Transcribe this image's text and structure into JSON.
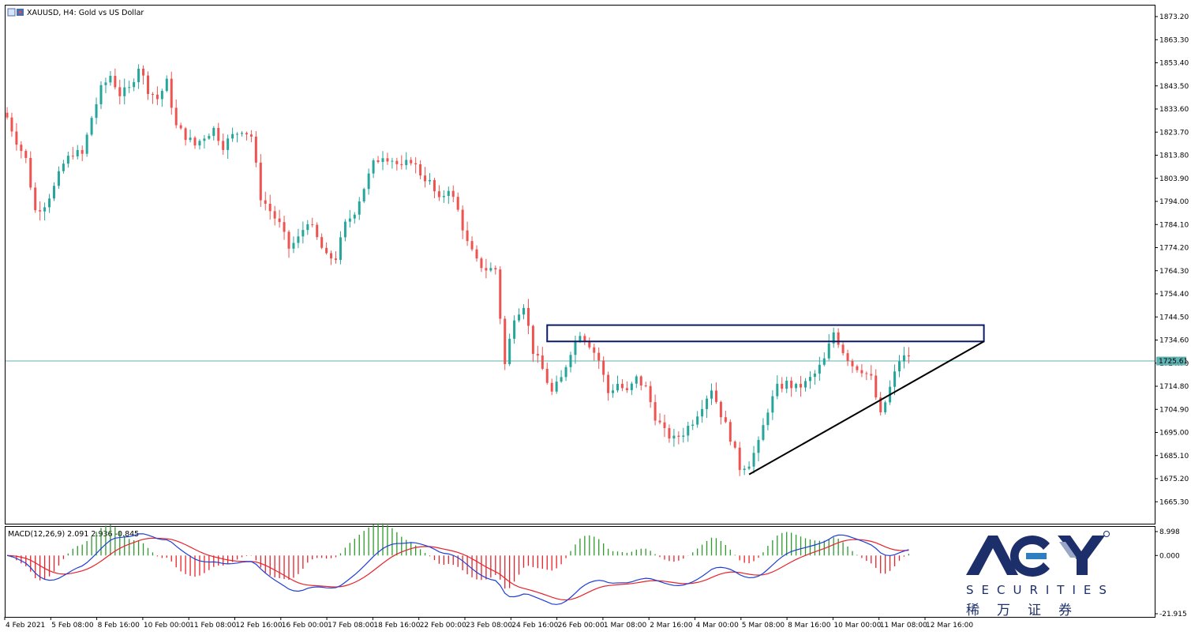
{
  "window": {
    "title": "XAUUSD, H4:  Gold vs US Dollar",
    "current_price_label": "1725.61"
  },
  "colors": {
    "bull": "#26a69a",
    "bear": "#ef5350",
    "macd_line": "#1e3fd6",
    "signal_line": "#e8222a",
    "hist_pos": "#2e9a2e",
    "hist_neg": "#e8222a",
    "price_line": "#5fb3b3",
    "box": "#0a1a66",
    "trendline": "#000000",
    "brand": "#1d2f6b"
  },
  "chart_data": [
    {
      "type": "candlestick",
      "title": "XAUUSD, H4:  Gold vs US Dollar",
      "price_axis": {
        "ticks": [
          "1873.20",
          "1863.30",
          "1853.40",
          "1843.50",
          "1833.60",
          "1823.70",
          "1813.80",
          "1803.90",
          "1794.00",
          "1784.10",
          "1774.20",
          "1764.30",
          "1754.40",
          "1744.50",
          "1734.60",
          "1724.70",
          "1714.80",
          "1704.90",
          "1695.00",
          "1685.10",
          "1675.20",
          "1665.30"
        ]
      },
      "time_axis": {
        "labels": [
          "4 Feb 2021",
          "5 Feb 08:00",
          "8 Feb 16:00",
          "10 Feb 00:00",
          "11 Feb 08:00",
          "12 Feb 16:00",
          "16 Feb 00:00",
          "17 Feb 08:00",
          "18 Feb 16:00",
          "22 Feb 00:00",
          "23 Feb 08:00",
          "24 Feb 16:00",
          "26 Feb 00:00",
          "1 Mar 08:00",
          "2 Mar 16:00",
          "4 Mar 00:00",
          "5 Mar 08:00",
          "8 Mar 16:00",
          "10 Mar 00:00",
          "11 Mar 08:00",
          "12 Mar 16:00"
        ]
      },
      "current_price": 1725.61,
      "close_path": [
        [
          0,
          1830
        ],
        [
          2,
          1820
        ],
        [
          4,
          1812
        ],
        [
          6,
          1790
        ],
        [
          8,
          1793
        ],
        [
          10,
          1800
        ],
        [
          12,
          1810
        ],
        [
          14,
          1815
        ],
        [
          16,
          1814
        ],
        [
          18,
          1830
        ],
        [
          20,
          1842
        ],
        [
          22,
          1848
        ],
        [
          24,
          1840
        ],
        [
          26,
          1842
        ],
        [
          28,
          1852
        ],
        [
          30,
          1842
        ],
        [
          32,
          1838
        ],
        [
          34,
          1845
        ],
        [
          36,
          1826
        ],
        [
          38,
          1822
        ],
        [
          40,
          1818
        ],
        [
          42,
          1822
        ],
        [
          44,
          1825
        ],
        [
          46,
          1818
        ],
        [
          48,
          1822
        ],
        [
          50,
          1825
        ],
        [
          52,
          1822
        ],
        [
          54,
          1796
        ],
        [
          56,
          1790
        ],
        [
          58,
          1784
        ],
        [
          60,
          1774
        ],
        [
          62,
          1778
        ],
        [
          64,
          1786
        ],
        [
          66,
          1778
        ],
        [
          68,
          1770
        ],
        [
          70,
          1770
        ],
        [
          72,
          1784
        ],
        [
          74,
          1790
        ],
        [
          76,
          1800
        ],
        [
          78,
          1810
        ],
        [
          80,
          1814
        ],
        [
          82,
          1812
        ],
        [
          84,
          1808
        ],
        [
          86,
          1812
        ],
        [
          88,
          1806
        ],
        [
          90,
          1802
        ],
        [
          92,
          1794
        ],
        [
          94,
          1800
        ],
        [
          96,
          1790
        ],
        [
          98,
          1776
        ],
        [
          100,
          1768
        ],
        [
          102,
          1765
        ],
        [
          104,
          1765
        ],
        [
          106,
          1724
        ],
        [
          108,
          1745
        ],
        [
          110,
          1750
        ],
        [
          112,
          1730
        ],
        [
          114,
          1722
        ],
        [
          116,
          1712
        ],
        [
          118,
          1718
        ],
        [
          120,
          1730
        ],
        [
          122,
          1738
        ],
        [
          124,
          1733
        ],
        [
          126,
          1726
        ],
        [
          128,
          1712
        ],
        [
          130,
          1716
        ],
        [
          132,
          1712
        ],
        [
          134,
          1718
        ],
        [
          136,
          1714
        ],
        [
          138,
          1702
        ],
        [
          140,
          1695
        ],
        [
          142,
          1692
        ],
        [
          144,
          1695
        ],
        [
          146,
          1700
        ],
        [
          148,
          1707
        ],
        [
          150,
          1714
        ],
        [
          152,
          1703
        ],
        [
          154,
          1693
        ],
        [
          156,
          1680
        ],
        [
          158,
          1682
        ],
        [
          160,
          1690
        ],
        [
          162,
          1705
        ],
        [
          164,
          1714
        ],
        [
          166,
          1716
        ],
        [
          168,
          1714
        ],
        [
          170,
          1716
        ],
        [
          172,
          1720
        ],
        [
          174,
          1726
        ],
        [
          176,
          1738
        ],
        [
          178,
          1730
        ],
        [
          180,
          1724
        ],
        [
          182,
          1722
        ],
        [
          184,
          1718
        ],
        [
          186,
          1702
        ],
        [
          188,
          1714
        ],
        [
          190,
          1726
        ],
        [
          192,
          1728
        ]
      ],
      "annotations": {
        "resistance_box": {
          "top": 1741,
          "bottom": 1734,
          "from_bar": 115,
          "to_bar": 208
        },
        "rising_trendline": {
          "from": [
            158,
            1677
          ],
          "to": [
            208,
            1734
          ]
        }
      }
    },
    {
      "type": "macd",
      "title": "MACD(12,26,9) 2.091 2.936 -0.845",
      "params": [
        12,
        26,
        9
      ],
      "values": {
        "macd": 2.091,
        "signal": 2.936,
        "histogram": -0.845
      },
      "y_ticks": [
        "8.998",
        "0.000",
        "-21.915"
      ],
      "ylim": [
        -21.915,
        8.998
      ]
    }
  ],
  "watermark": {
    "brand_text": "ACY",
    "sub_text": "SECURITIES",
    "cn_text": "稀万证券",
    "registered": "®"
  }
}
